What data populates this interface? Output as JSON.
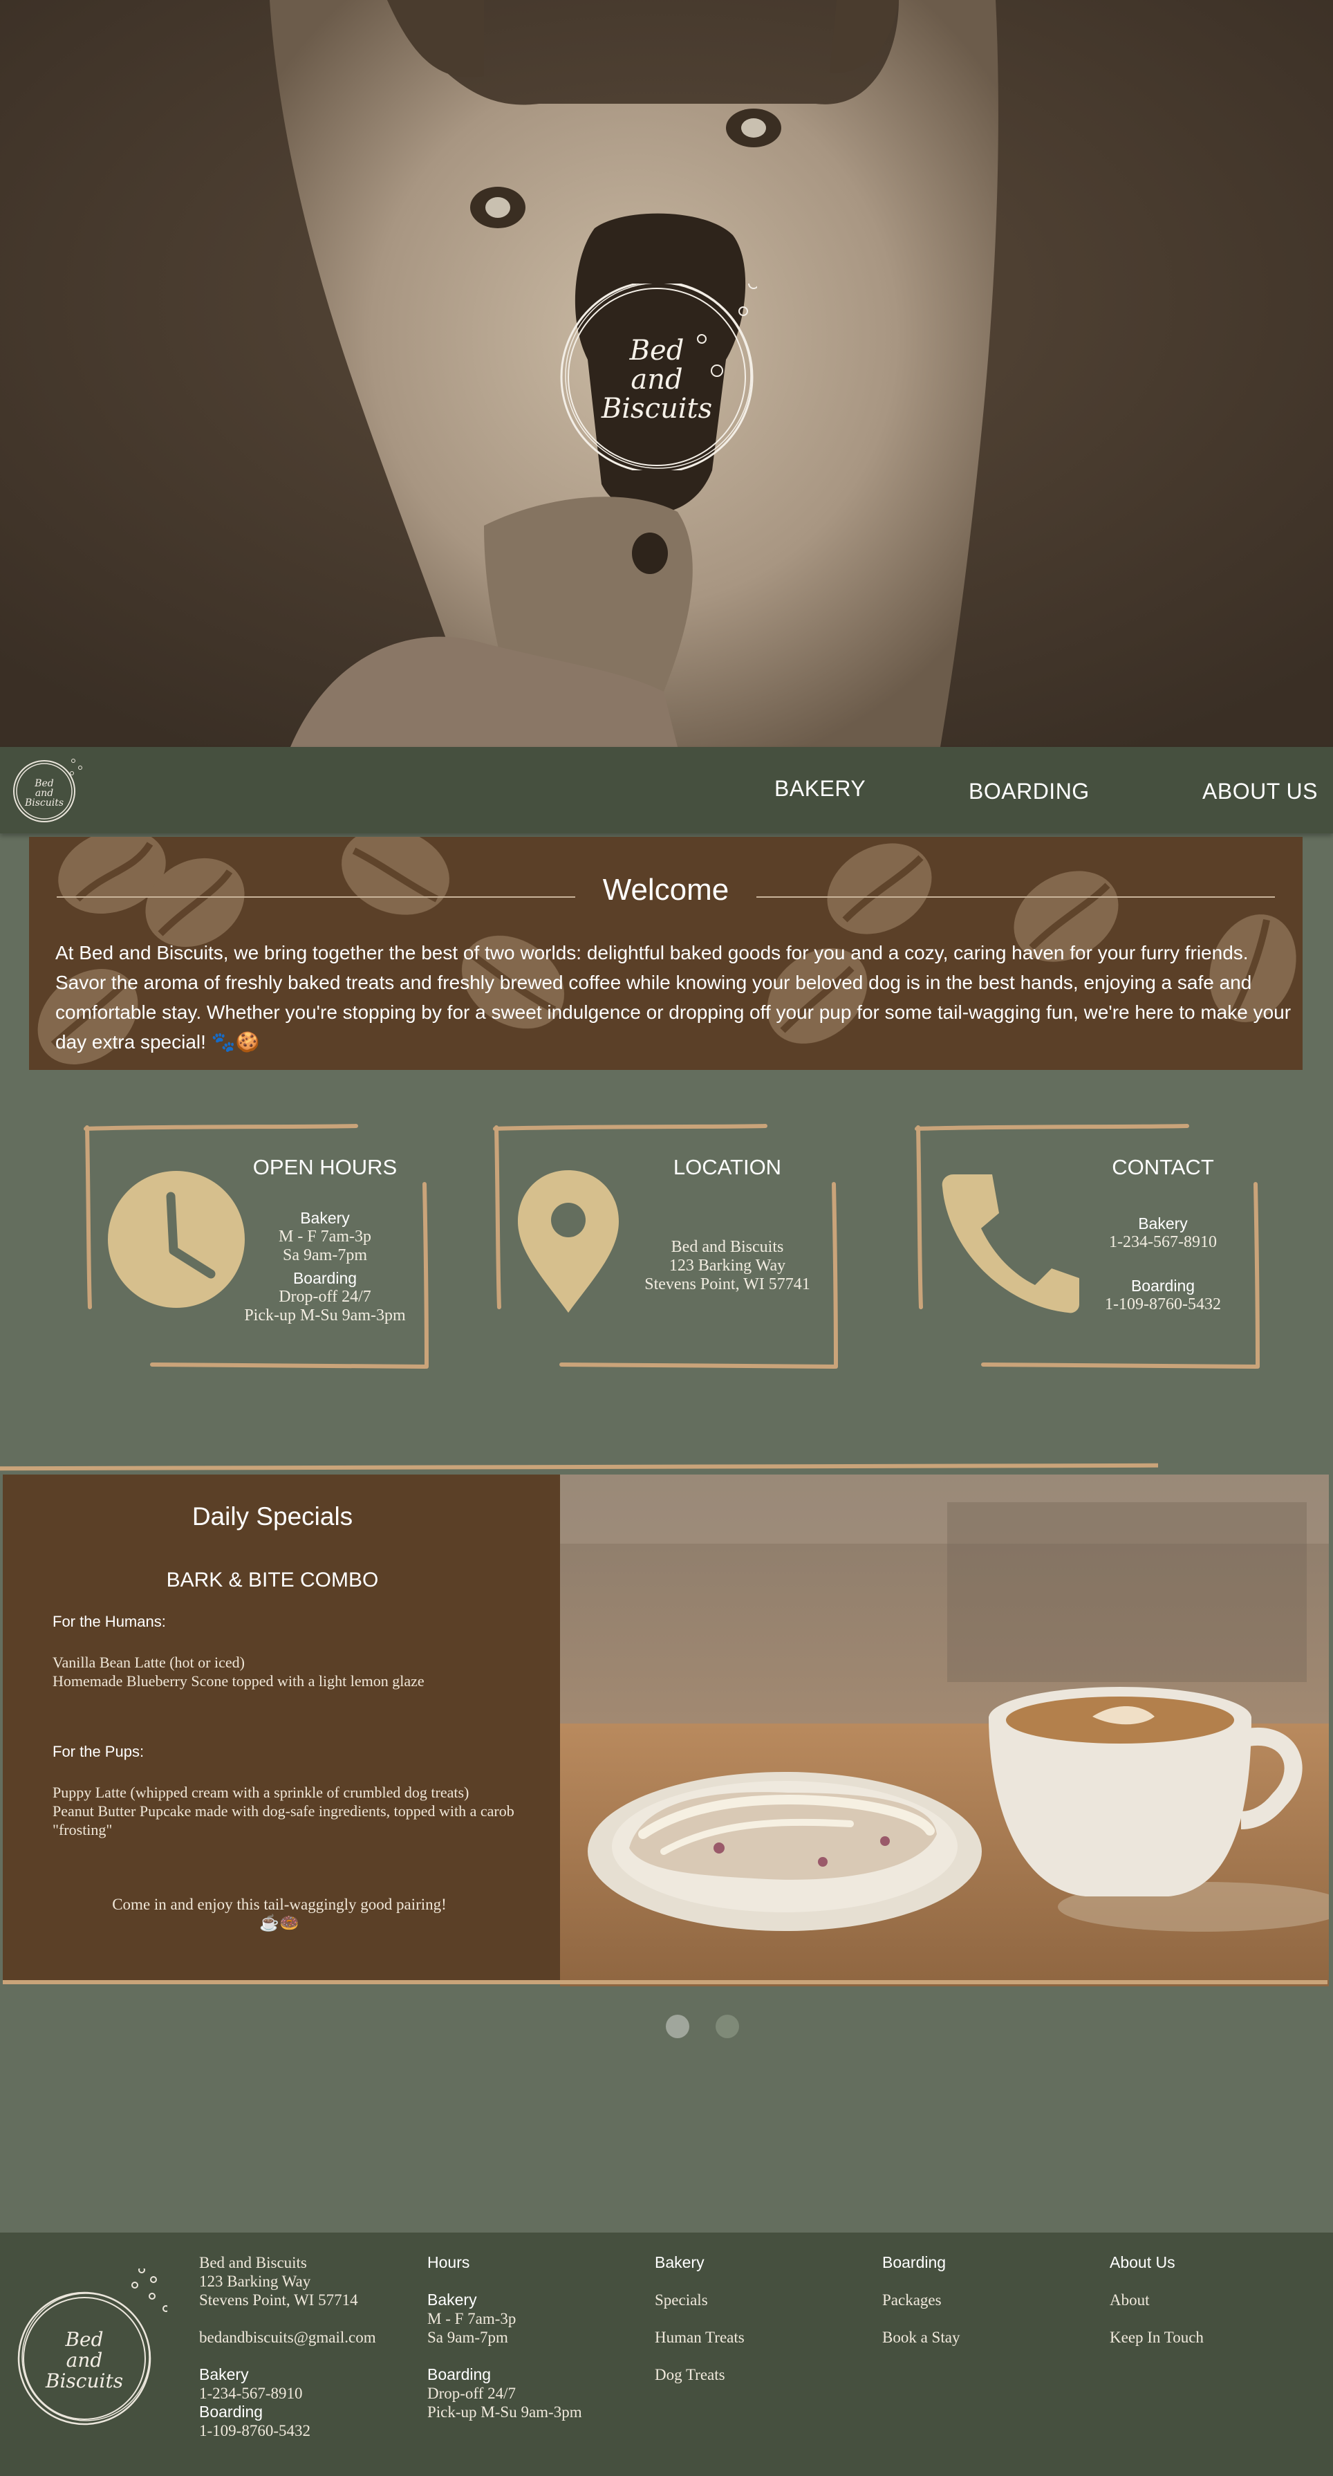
{
  "brand": {
    "logo_lines": [
      "Bed",
      "and",
      "Biscuits"
    ]
  },
  "nav": {
    "items": [
      "BAKERY",
      "BOARDING",
      "ABOUT US"
    ]
  },
  "welcome": {
    "title": "Welcome",
    "text": "At Bed and Biscuits, we bring together the best of two worlds: delightful baked goods for you and a cozy, caring haven for your furry friends. Savor the aroma of freshly baked treats and freshly brewed coffee while knowing your beloved dog is in the best hands, enjoying a safe and comfortable stay. Whether you're stopping by for a sweet indulgence or dropping off your pup for some tail-wagging fun, we're here to make your day extra special! 🐾🍪"
  },
  "cards": {
    "hours": {
      "title": "OPEN HOURS",
      "bakery_label": "Bakery",
      "bakery_lines": [
        "M - F 7am-3p",
        "Sa 9am-7pm"
      ],
      "boarding_label": "Boarding",
      "boarding_lines": [
        "Drop-off 24/7",
        "Pick-up M-Su 9am-3pm"
      ],
      "icon": "clock-icon"
    },
    "location": {
      "title": "LOCATION",
      "lines": [
        "Bed and Biscuits",
        "123 Barking Way",
        "Stevens Point, WI 57741"
      ],
      "icon": "map-pin-icon"
    },
    "contact": {
      "title": "CONTACT",
      "bakery_label": "Bakery",
      "bakery_phone": "1-234-567-8910",
      "boarding_label": "Boarding",
      "boarding_phone": "1-109-8760-5432",
      "icon": "phone-icon"
    }
  },
  "specials": {
    "title": "Daily Specials",
    "subtitle": "BARK & BITE COMBO",
    "humans_heading": "For the Humans:",
    "humans_items": [
      "Vanilla Bean Latte (hot or iced)",
      "Homemade Blueberry Scone topped with a light lemon glaze"
    ],
    "pups_heading": "For the Pups:",
    "pups_items": [
      "Puppy Latte (whipped cream with a sprinkle of crumbled dog treats)",
      "Peanut Butter Pupcake made with dog-safe ingredients, topped with a carob \"frosting\""
    ],
    "closing": "Come in and enjoy this tail-waggingly good pairing! ☕🍩"
  },
  "carousel": {
    "dot_count": 2,
    "active_index": 0
  },
  "footer": {
    "address_lines": [
      "Bed and Biscuits",
      "123 Barking Way",
      "Stevens Point, WI 57714"
    ],
    "email": "bedandbiscuits@gmail.com",
    "bakery_label": "Bakery",
    "bakery_phone": "1-234-567-8910",
    "boarding_label": "Boarding",
    "boarding_phone": "1-109-8760-5432",
    "hours_heading": "Hours",
    "hours_bakery_label": "Bakery",
    "hours_bakery_lines": [
      "M - F 7am-3p",
      "Sa 9am-7pm"
    ],
    "hours_boarding_label": "Boarding",
    "hours_boarding_lines": [
      "Drop-off 24/7",
      "Pick-up M-Su 9am-3pm"
    ],
    "bakery_heading": "Bakery",
    "bakery_links": [
      "Specials",
      "Human Treats",
      "Dog Treats"
    ],
    "boarding_heading": "Boarding",
    "boarding_links": [
      "Packages",
      "Book a Stay"
    ],
    "about_heading": "About Us",
    "about_links": [
      "About",
      "Keep In Touch"
    ]
  },
  "colors": {
    "page_bg": "#646e5e",
    "nav_bg": "#46503f",
    "brown": "#5b4028",
    "accent_tan": "#caa47a",
    "icon_tan": "#d6bf8d"
  }
}
